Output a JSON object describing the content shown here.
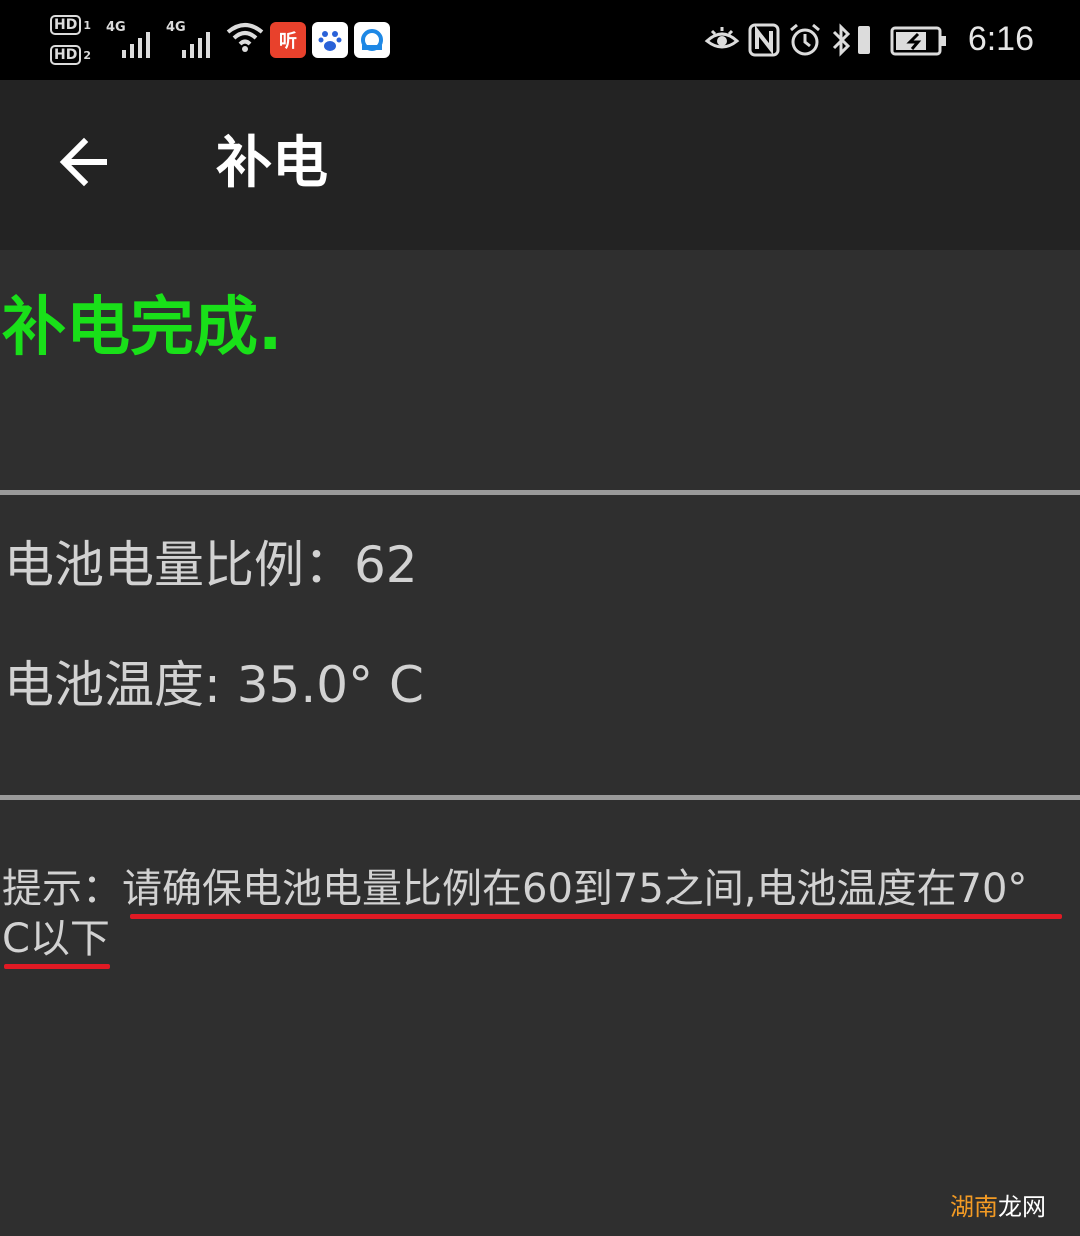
{
  "status_bar": {
    "sim1_badge": "HD",
    "sim1_index": "1",
    "sim2_badge": "HD",
    "sim2_index": "2",
    "network1": "4G",
    "network2": "4G",
    "app_icon_1": "听",
    "time": "6:16",
    "icons": [
      "eye-comfort-icon",
      "nfc-icon",
      "alarm-icon",
      "bluetooth-icon",
      "vibrate-icon",
      "battery-charging-icon"
    ]
  },
  "app_bar": {
    "title": "补电",
    "back_icon": "arrow-left-icon"
  },
  "content": {
    "status_message": "补电完成.",
    "battery_level_label": "电池电量比例：",
    "battery_level_value": "62",
    "battery_temp_label": "电池温度: ",
    "battery_temp_value": "35.0° C",
    "tip_label": "提示：",
    "tip_text_line1": "请确保电池电量比例在60到75之间,电池温度在70°",
    "tip_text_line2": "C以下"
  },
  "watermark": {
    "part1": "湖南",
    "part2": "龙网"
  },
  "colors": {
    "background": "#2f2f2f",
    "app_bar": "#232323",
    "status_bar": "#000000",
    "success_text": "#19e019",
    "annotation_underline": "#e01a24"
  }
}
